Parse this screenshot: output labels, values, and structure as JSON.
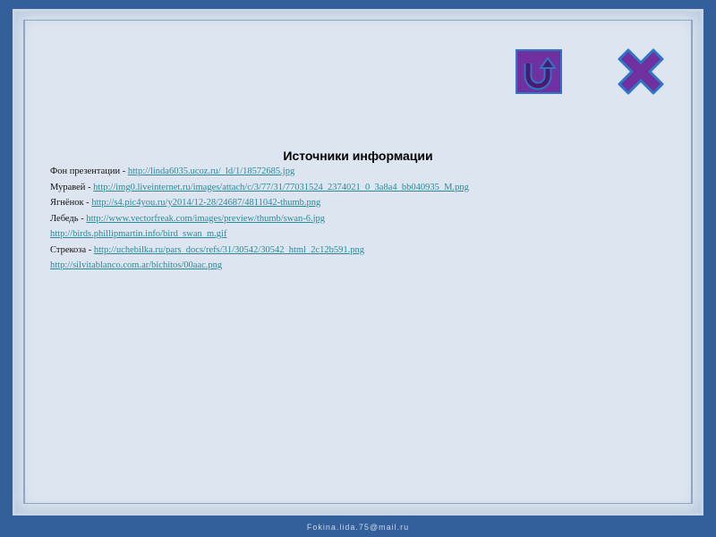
{
  "title": "Источники информации",
  "sources": [
    {
      "label": "Фон презентации - ",
      "url": "http://linda6035.ucoz.ru/_ld/1/18572685.jpg"
    },
    {
      "label": "Муравей - ",
      "url": "http://img0.liveinternet.ru/images/attach/c/3/77/31/77031524_2374021_0_3a8a4_bb040935_M.png"
    },
    {
      "label": "Ягнёнок - ",
      "url": "http://s4.pic4you.ru/y2014/12-28/24687/4811042-thumb.png"
    },
    {
      "label": "Лебедь - ",
      "url": "http://www.vectorfreak.com/images/preview/thumb/swan-6.jpg"
    },
    {
      "label": "",
      "url": "http://birds.phillipmartin.info/bird_swan_m.gif"
    },
    {
      "label": "Стрекоза - ",
      "url": "http://uchebilka.ru/pars_docs/refs/31/30542/30542_html_2c12b591.png"
    },
    {
      "label": "",
      "url": "http://silvitablanco.com.ar/bichitos/00aac.png"
    }
  ],
  "buttons": {
    "home_icon": "u-turn-arrow-icon",
    "close_icon": "close-x-icon"
  },
  "footer": "Fokina.lida.75@mail.ru",
  "colors": {
    "accent": "#7030a0",
    "border": "#2e75c8",
    "link": "#2a8a9a",
    "background": "#33609a"
  }
}
